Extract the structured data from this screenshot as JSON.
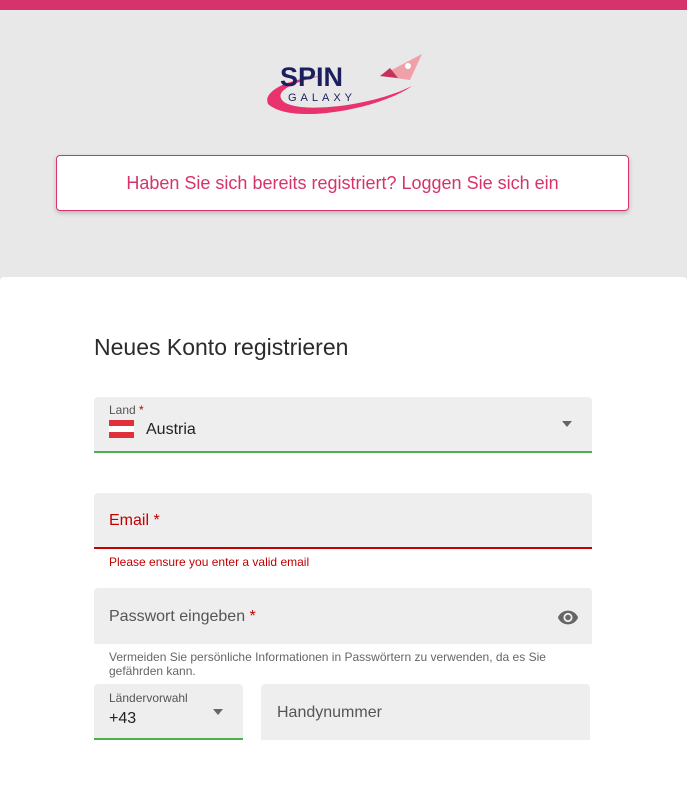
{
  "brand": {
    "logo_top": "SPIN",
    "logo_bottom": "GALAXY"
  },
  "login_prompt": "Haben Sie sich bereits registriert? Loggen Sie sich ein",
  "form": {
    "title": "Neues Konto registrieren",
    "country": {
      "label": "Land",
      "required_mark": "*",
      "value": "Austria",
      "flag_icon": "austria-flag-icon"
    },
    "email": {
      "label": "Email",
      "required_mark": "*",
      "error": "Please ensure you enter a valid email"
    },
    "password": {
      "label": "Passwort eingeben",
      "required_mark": "*",
      "hint": "Vermeiden Sie persönliche Informationen in Passwörtern zu verwenden, da es Sie gefährden kann.",
      "toggle_icon": "eye-icon"
    },
    "phone_prefix": {
      "label": "Ländervorwahl",
      "value": "+43"
    },
    "phone": {
      "placeholder": "Handynummer"
    }
  },
  "colors": {
    "accent": "#d6336c",
    "error": "#c40000",
    "valid": "#4caf50",
    "header_bg": "#e9e8e9",
    "field_bg": "#eeeeee"
  }
}
